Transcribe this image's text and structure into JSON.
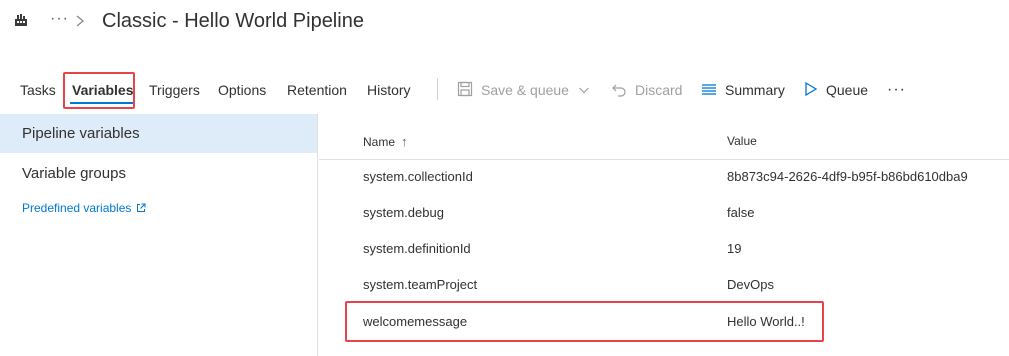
{
  "header": {
    "breadcrumb_ellipsis": "···",
    "title": "Classic - Hello World Pipeline",
    "icons": [
      "pipeline-icon",
      "chevron-right-icon"
    ]
  },
  "tabs": [
    {
      "label": "Tasks",
      "active": false
    },
    {
      "label": "Variables",
      "active": true
    },
    {
      "label": "Triggers",
      "active": false
    },
    {
      "label": "Options",
      "active": false
    },
    {
      "label": "Retention",
      "active": false
    },
    {
      "label": "History",
      "active": false
    }
  ],
  "toolbar": {
    "save_queue_label": "Save & queue",
    "discard_label": "Discard",
    "summary_label": "Summary",
    "queue_label": "Queue",
    "more_label": "···"
  },
  "sidebar": {
    "items": [
      {
        "label": "Pipeline variables",
        "selected": true
      },
      {
        "label": "Variable groups",
        "selected": false
      }
    ],
    "predefined_link": "Predefined variables"
  },
  "table": {
    "columns": {
      "name": "Name",
      "value": "Value",
      "sort_indicator": "↑"
    },
    "rows": [
      {
        "name": "system.collectionId",
        "value": "8b873c94-2626-4df9-b95f-b86bd610dba9"
      },
      {
        "name": "system.debug",
        "value": "false"
      },
      {
        "name": "system.definitionId",
        "value": "19"
      },
      {
        "name": "system.teamProject",
        "value": "DevOps"
      },
      {
        "name": "welcomemessage",
        "value": "Hello World..!"
      }
    ]
  },
  "colors": {
    "accent": "#0078d4",
    "highlight_border": "#e8434b",
    "selected_bg": "#deecf9",
    "disabled_text": "#a19f9d"
  }
}
